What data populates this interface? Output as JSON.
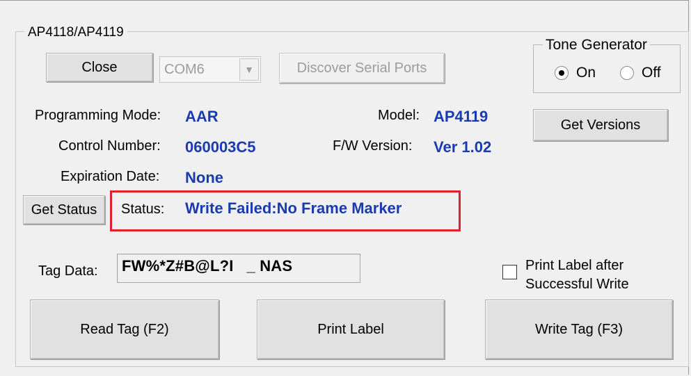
{
  "group": {
    "title": "AP4118/AP4119"
  },
  "connection": {
    "close_label": "Close",
    "port_value": "COM6",
    "discover_label": "Discover Serial Ports"
  },
  "tone_generator": {
    "title": "Tone Generator",
    "on_label": "On",
    "off_label": "Off",
    "selected": "On"
  },
  "info": {
    "programming_mode_label": "Programming Mode:",
    "programming_mode_value": "AAR",
    "control_number_label": "Control Number:",
    "control_number_value": "060003C5",
    "expiration_date_label": "Expiration Date:",
    "expiration_date_value": "None",
    "model_label": "Model:",
    "model_value": "AP4119",
    "fw_version_label": "F/W Version:",
    "fw_version_value": "Ver 1.02",
    "get_versions_label": "Get Versions"
  },
  "status": {
    "get_status_label": "Get Status",
    "status_label": "Status:",
    "status_value": "Write Failed:No Frame Marker",
    "highlight_color": "#e0202a"
  },
  "tag": {
    "tag_data_label": "Tag Data:",
    "tag_data_value": "FW%*Z#B@L?I   _ NAS",
    "print_after_write_line1": "Print Label after",
    "print_after_write_line2": "Successful Write",
    "print_after_write_checked": false
  },
  "actions": {
    "read_tag_label": "Read Tag (F2)",
    "print_label_label": "Print Label",
    "write_tag_label": "Write Tag (F3)"
  },
  "colors": {
    "value_text": "#1a3bb0",
    "window_bg": "#f0f0f0"
  }
}
